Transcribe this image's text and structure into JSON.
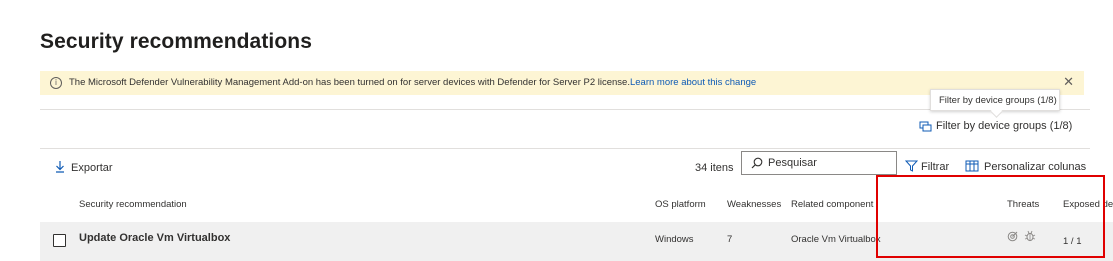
{
  "page": {
    "title": "Security recommendations"
  },
  "banner": {
    "text": "The Microsoft Defender Vulnerability Management Add-on has been turned on for server devices with Defender for Server P2 license.",
    "link": "Learn more about this change"
  },
  "tooltip": {
    "text": "Filter by device groups (1/8)"
  },
  "filter_device_groups": {
    "label": "Filter by device groups (1/8)"
  },
  "toolbar": {
    "export_label": "Exportar",
    "count_label": "34 itens",
    "search_placeholder": "Pesquisar",
    "filter_label": "Filtrar",
    "customize_label": "Personalizar colunas"
  },
  "table": {
    "columns": [
      "Security recommendation",
      "OS platform",
      "Weaknesses",
      "Related component",
      "Threats",
      "Exposed de"
    ],
    "rows": [
      {
        "recommendation": "Update Oracle Vm Virtualbox",
        "os_platform": "Windows",
        "weaknesses": "7",
        "related_component": "Oracle Vm Virtualbox",
        "threat_icons": [
          "target-icon",
          "bug-icon"
        ],
        "exposed_devices": "1 / 1"
      }
    ]
  },
  "colors": {
    "accent": "#0f5bb5",
    "banner_bg": "#fdf5d4",
    "highlight_box": "#e00000",
    "row_bg": "#f0f0f0"
  }
}
